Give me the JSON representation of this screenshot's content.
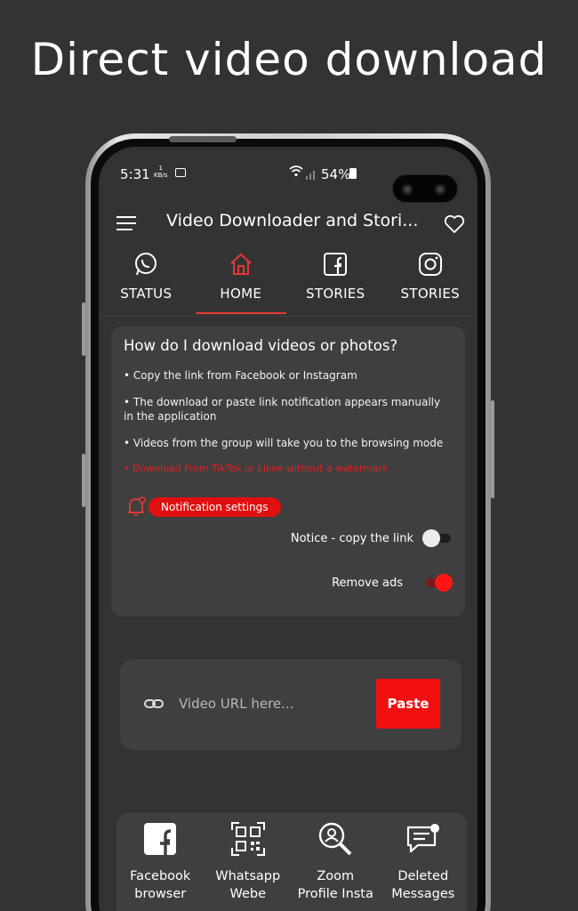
{
  "headline": "Direct video download",
  "status_bar": {
    "time": "5:31",
    "data_rate_value": "1",
    "data_rate_unit": "KB/s",
    "battery": "54%"
  },
  "app_bar": {
    "title": "Video Downloader and Stori..."
  },
  "tabs": [
    {
      "label": "STATUS",
      "icon": "whatsapp-icon"
    },
    {
      "label": "HOME",
      "icon": "home-icon",
      "active": true
    },
    {
      "label": "STORIES",
      "icon": "facebook-icon"
    },
    {
      "label": "STORIES",
      "icon": "instagram-icon"
    }
  ],
  "info": {
    "title": "How do I download videos or photos?",
    "lines": [
      "• Copy the link from Facebook or Instagram",
      "• The download or paste link notification appears manually in the application",
      "• Videos from the group will take you to the browsing mode"
    ],
    "red_note": "• Download From TikTok or Likee without a watermark",
    "notification_button": "Notification settings",
    "notice_label": "Notice - copy the link",
    "notice_on": false,
    "remove_ads_label": "Remove ads",
    "remove_ads_on": true
  },
  "url": {
    "placeholder": "Video URL here...",
    "paste": "Paste"
  },
  "tools": [
    {
      "label": "Facebook\nbrowser",
      "icon": "facebook-square-icon"
    },
    {
      "label": "Whatsapp\nWebe",
      "icon": "qr-code-icon"
    },
    {
      "label": "Zoom\nProfile Insta",
      "icon": "zoom-search-icon"
    },
    {
      "label": "Deleted\nMessages",
      "icon": "chat-bubble-icon"
    }
  ],
  "colors": {
    "accent": "#E53935",
    "background": "#333333",
    "card": "#3F3F3F"
  }
}
